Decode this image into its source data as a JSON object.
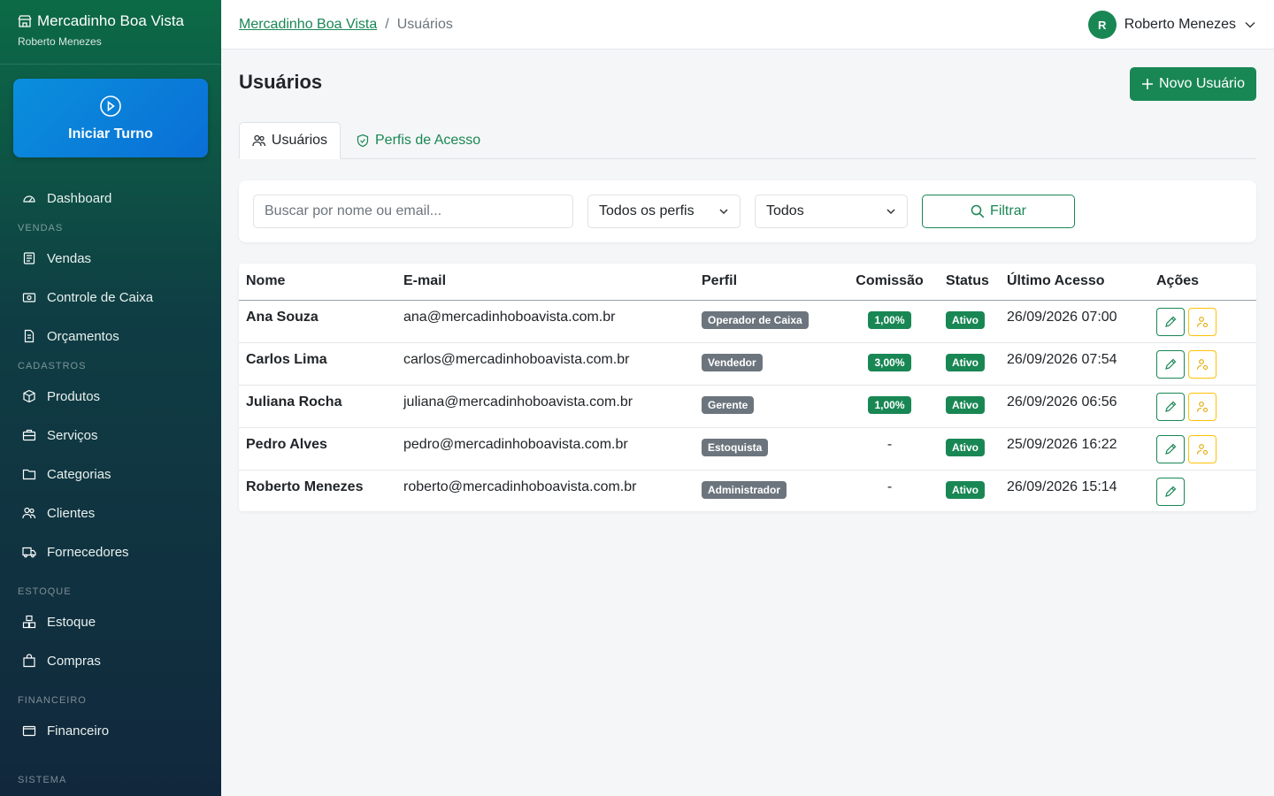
{
  "brand": {
    "name": "Mercadinho Boa Vista",
    "user": "Roberto Menezes"
  },
  "shift_button": {
    "label": "Iniciar Turno"
  },
  "nav": {
    "dashboard": "Dashboard",
    "sec_vendas": "VENDAS",
    "vendas": "Vendas",
    "controle_caixa": "Controle de Caixa",
    "orcamentos": "Orçamentos",
    "sec_cadastros": "CADASTROS",
    "produtos": "Produtos",
    "servicos": "Serviços",
    "categorias": "Categorias",
    "clientes": "Clientes",
    "fornecedores": "Fornecedores",
    "sec_estoque": "ESTOQUE",
    "estoque": "Estoque",
    "compras": "Compras",
    "sec_financeiro": "FINANCEIRO",
    "financeiro": "Financeiro",
    "sec_sistema": "SISTEMA"
  },
  "breadcrumb": {
    "home": "Mercadinho Boa Vista",
    "separator": "/",
    "current": "Usuários"
  },
  "user_menu": {
    "initial": "R",
    "name": "Roberto Menezes"
  },
  "page": {
    "title": "Usuários",
    "new_button": "Novo Usuário"
  },
  "tabs": {
    "users": "Usuários",
    "profiles": "Perfis de Acesso"
  },
  "filters": {
    "search_placeholder": "Buscar por nome ou email...",
    "profile_select": "Todos os perfis",
    "status_select": "Todos",
    "filter_button": "Filtrar"
  },
  "table": {
    "headers": {
      "nome": "Nome",
      "email": "E-mail",
      "perfil": "Perfil",
      "comissao": "Comissão",
      "status": "Status",
      "ultimo": "Último Acesso",
      "acoes": "Ações"
    },
    "rows": [
      {
        "nome": "Ana Souza",
        "email": "ana@mercadinhoboavista.com.br",
        "perfil": "Operador de Caixa",
        "comissao": "1,00%",
        "status": "Ativo",
        "ultimo": "26/09/2026 07:00"
      },
      {
        "nome": "Carlos Lima",
        "email": "carlos@mercadinhoboavista.com.br",
        "perfil": "Vendedor",
        "comissao": "3,00%",
        "status": "Ativo",
        "ultimo": "26/09/2026 07:54"
      },
      {
        "nome": "Juliana Rocha",
        "email": "juliana@mercadinhoboavista.com.br",
        "perfil": "Gerente",
        "comissao": "1,00%",
        "status": "Ativo",
        "ultimo": "26/09/2026 06:56"
      },
      {
        "nome": "Pedro Alves",
        "email": "pedro@mercadinhoboavista.com.br",
        "perfil": "Estoquista",
        "comissao": "-",
        "status": "Ativo",
        "ultimo": "25/09/2026 16:22"
      },
      {
        "nome": "Roberto Menezes",
        "email": "roberto@mercadinhoboavista.com.br",
        "perfil": "Administrador",
        "comissao": "-",
        "status": "Ativo",
        "ultimo": "26/09/2026 15:14"
      }
    ]
  },
  "colors": {
    "primary": "#198754",
    "shift": "#0a8fdc",
    "warning": "#ffc107",
    "badge_gray": "#6c757d"
  }
}
